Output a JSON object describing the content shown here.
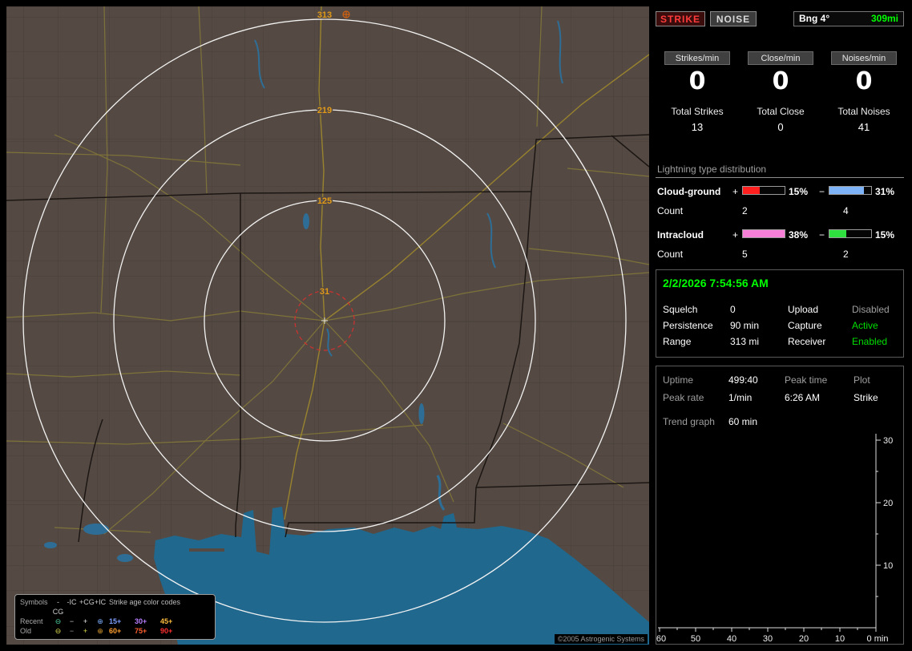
{
  "map": {
    "range_labels": [
      "313",
      "219",
      "125",
      "31"
    ],
    "range_label_color": "#e09a18",
    "ring_color": "#f2f2f2",
    "alarm_ring_color": "#d03030",
    "copyright": "©2005 Astrogenic Systems",
    "legend": {
      "symbols_header": "Symbols",
      "symbol_cols": [
        "-CG",
        "-IC",
        "+CG",
        "+IC"
      ],
      "age_header": "Strike age color codes",
      "recent_label": "Recent",
      "old_label": "Old",
      "recent_symbols": [
        {
          "glyph": "⊖",
          "color": "#4fcf9f"
        },
        {
          "glyph": "−",
          "color": "#cfcfcf"
        },
        {
          "glyph": "+",
          "color": "#e8e8e8"
        },
        {
          "glyph": "⊕",
          "color": "#7fafff"
        }
      ],
      "old_symbols": [
        {
          "glyph": "⊖",
          "color": "#dfdf4f"
        },
        {
          "glyph": "−",
          "color": "#9f9f9f"
        },
        {
          "glyph": "+",
          "color": "#dfdf4f"
        },
        {
          "glyph": "⊕",
          "color": "#df9f2f"
        }
      ],
      "recent_ages": [
        {
          "label": "15+",
          "color": "#7f9fff"
        },
        {
          "label": "30+",
          "color": "#b97fff"
        },
        {
          "label": "45+",
          "color": "#ffbf3f"
        }
      ],
      "old_ages": [
        {
          "label": "60+",
          "color": "#ff9f2f"
        },
        {
          "label": "75+",
          "color": "#ff5f2f"
        },
        {
          "label": "90+",
          "color": "#ff2f2f"
        }
      ]
    }
  },
  "sidebar": {
    "controls": {
      "strike": "STRIKE",
      "noise": "NOISE",
      "bearing_label": "Bng 4°",
      "bearing_value": "309mi",
      "bearing_value_color": "#00ff00"
    },
    "rates": [
      {
        "label": "Strikes/min",
        "value": "0"
      },
      {
        "label": "Close/min",
        "value": "0"
      },
      {
        "label": "Noises/min",
        "value": "0"
      }
    ],
    "totals": [
      {
        "label": "Total Strikes",
        "value": "13"
      },
      {
        "label": "Total Close",
        "value": "0"
      },
      {
        "label": "Total Noises",
        "value": "41"
      }
    ],
    "distribution": {
      "title": "Lightning type distribution",
      "count_label": "Count",
      "rows": [
        {
          "label": "Cloud-ground",
          "plus_sign": "+",
          "minus_sign": "−",
          "plus_pct": "15%",
          "minus_pct": "31%",
          "plus_count": "2",
          "minus_count": "4",
          "plus_color": "#ff1f1f",
          "minus_color": "#7fb3f7",
          "plus_fill": 40,
          "minus_fill": 82
        },
        {
          "label": "Intracloud",
          "plus_sign": "+",
          "minus_sign": "−",
          "plus_pct": "38%",
          "minus_pct": "15%",
          "plus_count": "5",
          "minus_count": "2",
          "plus_color": "#f77fd7",
          "minus_color": "#2fdf3f",
          "plus_fill": 100,
          "minus_fill": 40
        }
      ]
    },
    "status": {
      "datetime": "2/2/2026 7:54:56 AM",
      "datetime_color": "#00ff00",
      "rows": [
        {
          "label1": "Squelch",
          "value1": "0",
          "label2": "Upload",
          "value2": "Disabled",
          "value2_color": "#9f9f9f"
        },
        {
          "label1": "Persistence",
          "value1": "90 min",
          "label2": "Capture",
          "value2": "Active",
          "value2_color": "#00df00"
        },
        {
          "label1": "Range",
          "value1": "313 mi",
          "label2": "Receiver",
          "value2": "Enabled",
          "value2_color": "#00df00"
        }
      ]
    },
    "info": {
      "uptime_label": "Uptime",
      "uptime_value": "499:40",
      "peak_time_label": "Peak time",
      "peak_time_value": "6:26 AM",
      "plot_label": "Plot",
      "plot_value": "Strike",
      "peak_rate_label": "Peak rate",
      "peak_rate_value": "1/min",
      "trend_label": "Trend graph",
      "trend_value": "60 min"
    }
  },
  "chart_data": {
    "type": "line",
    "title": "Strike trend graph (60 min)",
    "xlabel": "min",
    "ylabel": "",
    "xlim": [
      60,
      0
    ],
    "ylim": [
      0,
      30
    ],
    "x_ticks": [
      "60",
      "50",
      "40",
      "30",
      "20",
      "10",
      "0 min"
    ],
    "y_ticks": [
      "30",
      "20",
      "10"
    ],
    "series": []
  }
}
